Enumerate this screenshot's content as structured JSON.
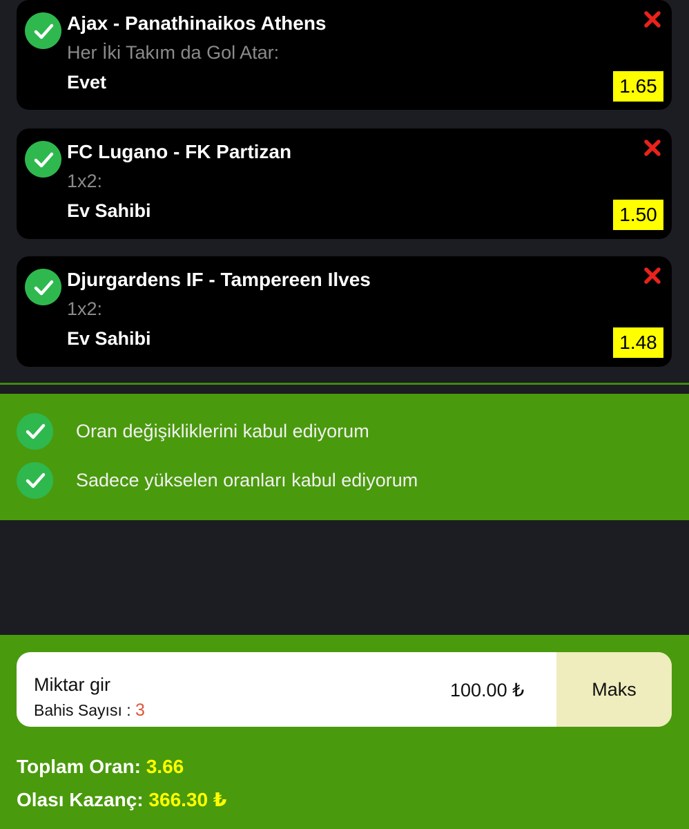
{
  "bets": [
    {
      "match": "Ajax - Panathinaikos Athens",
      "market": "Her İki Takım da Gol Atar:",
      "pick": "Evet",
      "odds": "1.65"
    },
    {
      "match": "FC Lugano - FK Partizan",
      "market": "1x2:",
      "pick": "Ev Sahibi",
      "odds": "1.50"
    },
    {
      "match": "Djurgardens IF - Tampereen Ilves",
      "market": "1x2:",
      "pick": "Ev Sahibi",
      "odds": "1.48"
    }
  ],
  "options": [
    {
      "label": "Oran değişikliklerini kabul ediyorum",
      "checked": true
    },
    {
      "label": "Sadece yükselen oranları kabul ediyorum",
      "checked": true
    }
  ],
  "stake": {
    "title": "Miktar gir",
    "bet_count_label": "Bahis Sayısı :",
    "bet_count": "3",
    "amount": "100.00 ₺",
    "max_label": "Maks"
  },
  "summary": {
    "total_odds_label": "Toplam Oran:",
    "total_odds": "3.66",
    "potential_win_label": "Olası Kazanç:",
    "potential_win": "366.30 ₺"
  },
  "colors": {
    "green_panel": "#4a9a0d",
    "check_green": "#2fb84e",
    "odds_bg": "#ffff00",
    "remove_red": "#e8231b",
    "max_bg": "#efecbd"
  }
}
